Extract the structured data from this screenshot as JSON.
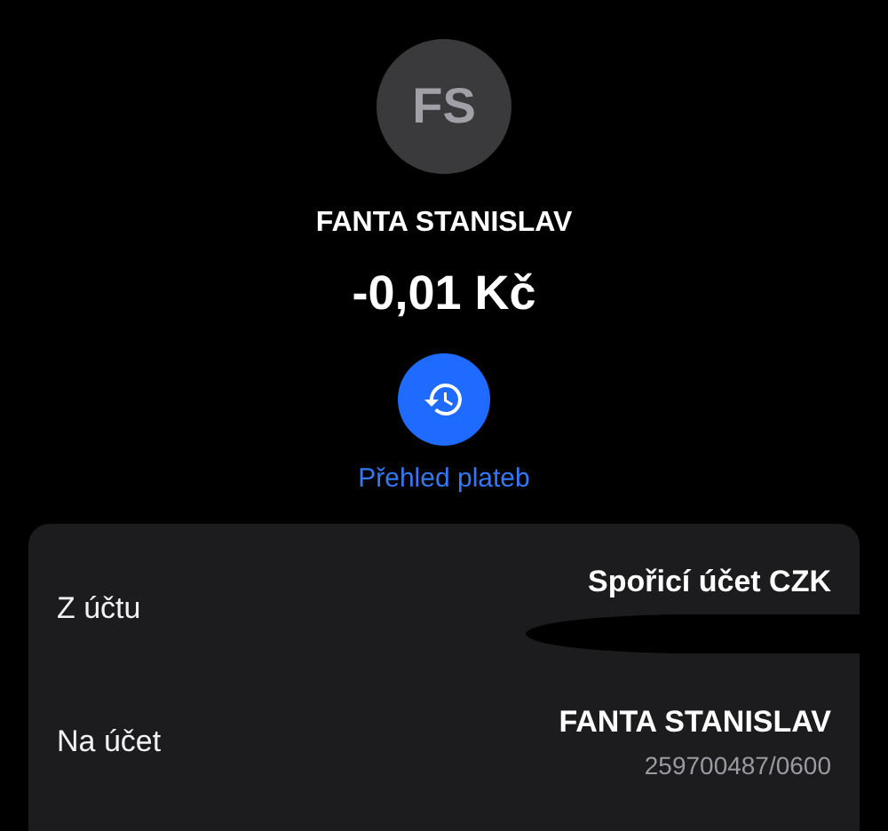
{
  "payee": {
    "initials": "FS",
    "name": "FANTA STANISLAV",
    "amount": "-0,01 Kč"
  },
  "history_link": {
    "label": "Přehled plateb"
  },
  "details": [
    {
      "label": "Z účtu",
      "value": "Spořicí účet CZK",
      "redacted": true
    },
    {
      "label": "Na účet",
      "value": "FANTA STANISLAV",
      "subvalue": "259700487/0600",
      "redacted": false
    }
  ]
}
